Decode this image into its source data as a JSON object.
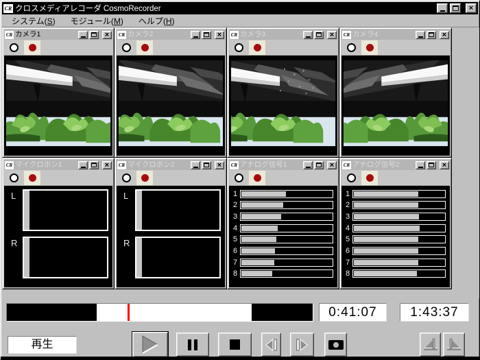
{
  "app": {
    "icon_label": "CR",
    "title": "クロスメディアレコーダ CosmoRecorder"
  },
  "titlebar_buttons": {
    "minimize": "minimize",
    "maximize": "maximize",
    "close": "close"
  },
  "menu_bar": {
    "items": [
      {
        "pre": "システム(",
        "key": "S",
        "post": ")"
      },
      {
        "pre": "モジュール(",
        "key": "M",
        "post": ")"
      },
      {
        "pre": "ヘルプ(",
        "key": "H",
        "post": ")"
      }
    ]
  },
  "modules": [
    {
      "title": "カメラ1",
      "type": "camera",
      "active": true
    },
    {
      "title": "カメラ2",
      "type": "camera",
      "active": false
    },
    {
      "title": "カメラ3",
      "type": "camera",
      "active": false
    },
    {
      "title": "カメラ4",
      "type": "camera",
      "active": false
    },
    {
      "title": "マイクロホン1",
      "type": "microphone",
      "active": false,
      "channels": [
        {
          "label": "L",
          "level": 7
        },
        {
          "label": "R",
          "level": 7
        }
      ]
    },
    {
      "title": "マイクロホン2",
      "type": "microphone",
      "active": false,
      "channels": [
        {
          "label": "L",
          "level": 7
        },
        {
          "label": "R",
          "level": 7
        }
      ]
    },
    {
      "title": "アナログ信号1",
      "type": "analog",
      "active": false,
      "channels": [
        {
          "label": "1",
          "level": 49
        },
        {
          "label": "2",
          "level": 46
        },
        {
          "label": "3",
          "level": 44
        },
        {
          "label": "4",
          "level": 40
        },
        {
          "label": "5",
          "level": 39
        },
        {
          "label": "6",
          "level": 37
        },
        {
          "label": "7",
          "level": 36
        },
        {
          "label": "8",
          "level": 34
        }
      ]
    },
    {
      "title": "アナログ信号2",
      "type": "analog",
      "active": false,
      "channels": [
        {
          "label": "1",
          "level": 71
        },
        {
          "label": "2",
          "level": 71
        },
        {
          "label": "3",
          "level": 72
        },
        {
          "label": "4",
          "level": 73
        },
        {
          "label": "5",
          "level": 71
        },
        {
          "label": "6",
          "level": 71
        },
        {
          "label": "7",
          "level": 71
        },
        {
          "label": "8",
          "level": 70
        }
      ]
    }
  ],
  "timeline": {
    "segments": [
      {
        "color": "#000000",
        "from": 0.0,
        "to": 0.293
      },
      {
        "color": "#ffffff",
        "from": 0.293,
        "to": 0.8
      },
      {
        "color": "#000000",
        "from": 0.8,
        "to": 1.0
      }
    ],
    "playhead_position": 0.396,
    "playhead_color": "#ff0000"
  },
  "time_display": {
    "current": "0:41:07",
    "total": "1:43:37"
  },
  "transport": {
    "status_label": "再生",
    "buttons": [
      {
        "name": "play",
        "active": true
      },
      {
        "name": "pause",
        "active": false
      },
      {
        "name": "stop",
        "active": false
      },
      {
        "name": "step-back",
        "active": false
      },
      {
        "name": "step-forward",
        "active": false
      },
      {
        "name": "snapshot",
        "active": false
      },
      {
        "name": "marker-in",
        "active": false
      },
      {
        "name": "marker-out",
        "active": false
      }
    ]
  },
  "colors": {
    "main_titlebar_bg": "#000000",
    "chrome": "#c0c0c0",
    "record_dot": "#a50d0d",
    "meter_fill": "#c8c8c8",
    "playhead": "#ff0000"
  }
}
